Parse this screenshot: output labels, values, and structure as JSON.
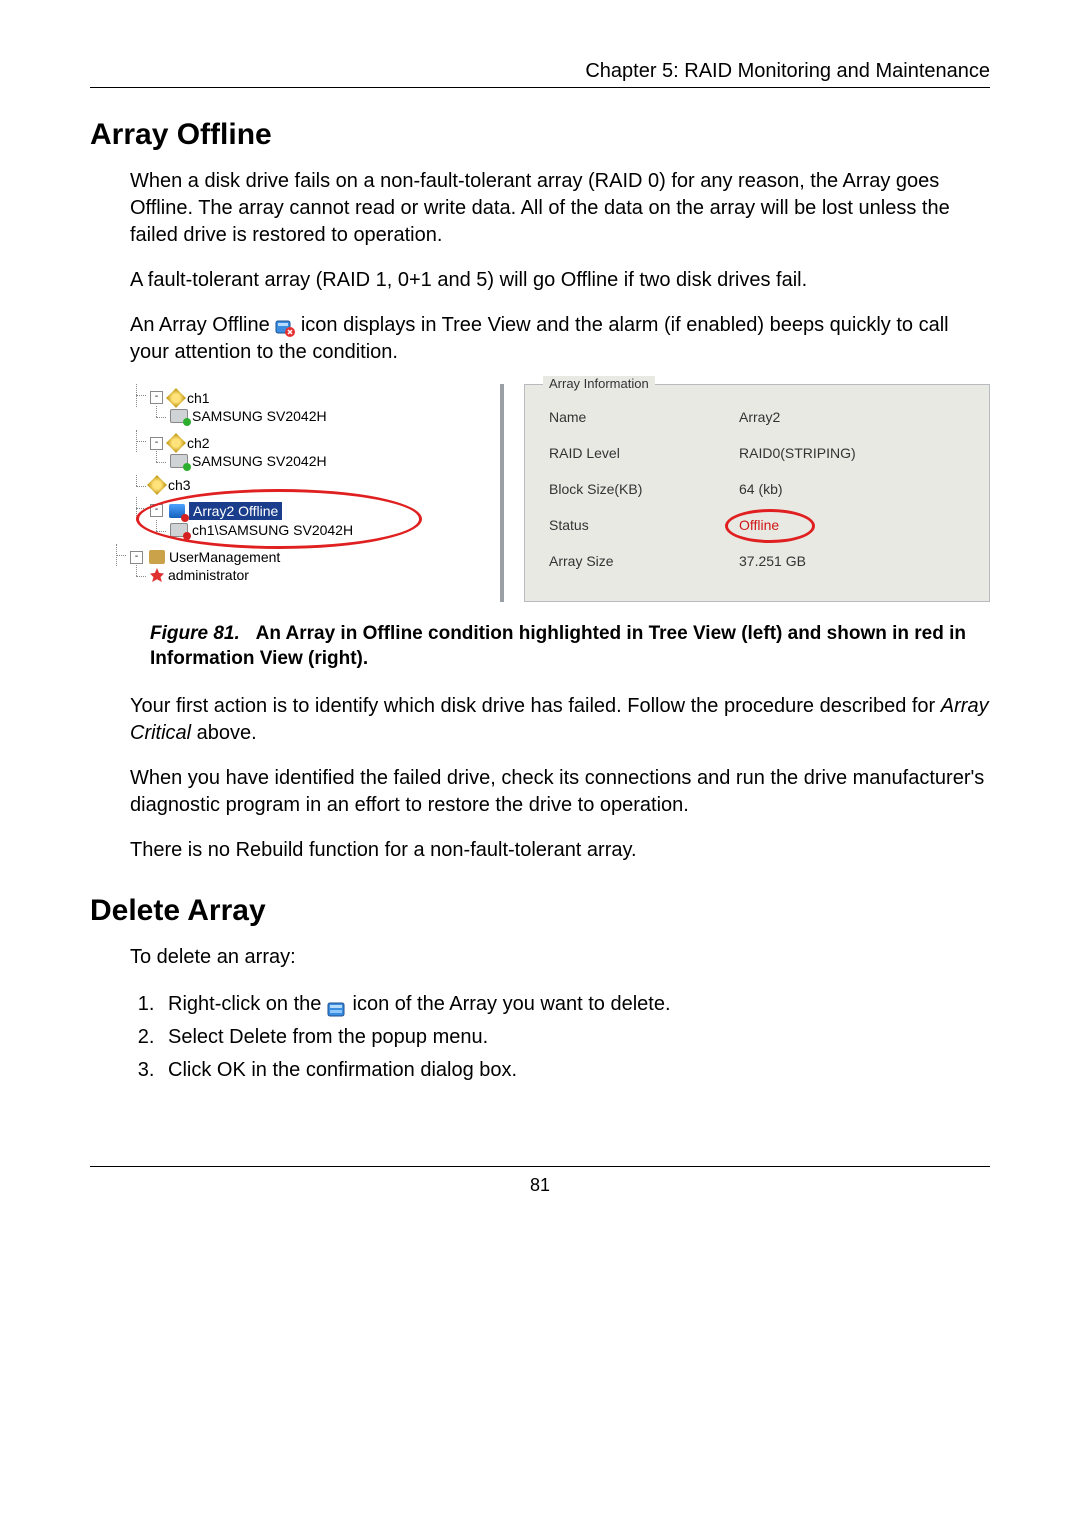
{
  "header": {
    "chapter": "Chapter 5: RAID Monitoring and Maintenance"
  },
  "section_array_offline": {
    "title": "Array Offline",
    "p1": "When a disk drive fails on a non-fault-tolerant array (RAID 0) for any reason, the Array goes Offline. The array cannot read or write data. All of the data on the array will be lost unless the failed drive is restored to operation.",
    "p2": "A fault-tolerant array (RAID 1, 0+1 and 5) will go Offline if two disk drives fail.",
    "p3_a": "An Array Offline ",
    "p3_b": " icon displays in Tree View and the alarm (if enabled) beeps quickly to call your attention to the condition.",
    "p_after_fig_a": "Your first action is to identify which disk drive has failed. Follow the procedure described for ",
    "array_critical": "Array Critical",
    "p_after_fig_b": " above.",
    "p_ident": "When you have identified the failed drive, check its connections and run the drive manufacturer's diagnostic program in an effort to restore the drive to operation.",
    "p_rebuild": "There is no Rebuild function for a non-fault-tolerant array."
  },
  "tree": {
    "ch1": "ch1",
    "ch1_disk": "SAMSUNG SV2042H",
    "ch2": "ch2",
    "ch2_disk": "SAMSUNG SV2042H",
    "ch3": "ch3",
    "array_offline_label": "Array2 Offline",
    "array_child": "ch1\\SAMSUNG SV2042H",
    "user_mgmt": "UserManagement",
    "admin": "administrator"
  },
  "info_panel": {
    "legend": "Array Information",
    "rows": {
      "name_label": "Name",
      "name_value": "Array2",
      "raid_label": "RAID Level",
      "raid_value": "RAID0(STRIPING)",
      "block_label": "Block Size(KB)",
      "block_value": "64 (kb)",
      "status_label": "Status",
      "status_value": "Offline",
      "size_label": "Array Size",
      "size_value": "37.251 GB"
    }
  },
  "figure_caption": {
    "label": "Figure 81.",
    "text": "An Array in Offline condition highlighted in Tree View (left) and shown in red in Information View (right)."
  },
  "section_delete_array": {
    "title": "Delete Array",
    "intro": "To delete an array:",
    "step1_a": "Right-click on the ",
    "step1_b": " icon of the Array you want to delete.",
    "step2": "Select Delete from the popup menu.",
    "step3": "Click OK in the confirmation dialog box."
  },
  "page_number": "81",
  "icons": {
    "array_offline": "array-offline-icon",
    "array": "array-icon"
  }
}
